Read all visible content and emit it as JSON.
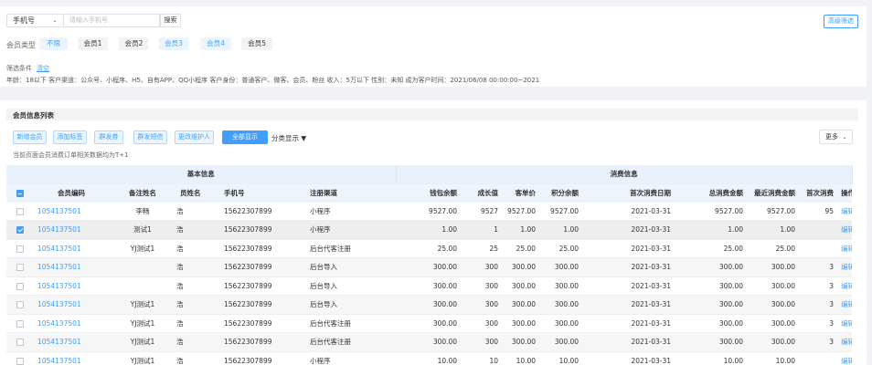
{
  "search": {
    "field_select": "手机号",
    "placeholder": "请输入手机号",
    "search_label": "搜索",
    "advanced_label": "高级筛选"
  },
  "member_type": {
    "label": "会员类型",
    "options": [
      "不限",
      "会员1",
      "会员2",
      "会员3",
      "会员4",
      "会员5"
    ]
  },
  "conditions": {
    "label": "筛选条件",
    "clear": "清空",
    "detail": "年龄：18以下  客户渠道：公众号、小程序、H5、自有APP、QQ小程序  客户身份：普通客户、微客、会员、粉丝  收入：5万以下  性别：未知  成为客户时间：2021/06/08 00:00:00~2021"
  },
  "list": {
    "title": "会员信息列表",
    "actions": [
      "新增会员",
      "添加标签",
      "群发券",
      "群发短信",
      "更改维护人",
      "全部显示"
    ],
    "category_display": "分类显示",
    "more": "更多",
    "note": "当前页面会员消费订单相关数据均为T+1"
  },
  "table": {
    "groups": [
      "基本信息",
      "消费信息"
    ],
    "columns": [
      "会员编码",
      "备注姓名",
      "员姓名",
      "手机号",
      "注册渠道",
      "钱包余额",
      "成长值",
      "客单价",
      "积分余额",
      "首次消费日期",
      "总消费金额",
      "最近消费金额",
      "首次消费",
      "操作"
    ],
    "rows": [
      {
        "code": "1054137501",
        "remark": "李畅",
        "name": "浩",
        "phone": "15622307899",
        "channel": "小程序",
        "wallet": "9527.00",
        "growth": "9527",
        "unit": "9527.00",
        "points": "9527.00",
        "first_date": "2021-03-31",
        "total": "9527.00",
        "recent": "9527.00",
        "first": "95",
        "op": "编辑",
        "checked": false
      },
      {
        "code": "1054137501",
        "remark": "测试1",
        "name": "浩",
        "phone": "15622307899",
        "channel": "小程序",
        "wallet": "1.00",
        "growth": "1",
        "unit": "1.00",
        "points": "1.00",
        "first_date": "2021-03-31",
        "total": "1.00",
        "recent": "1.00",
        "first": "",
        "op": "编辑",
        "checked": true
      },
      {
        "code": "1054137501",
        "remark": "YJ测试1",
        "name": "浩",
        "phone": "15622307899",
        "channel": "后台代客注册",
        "wallet": "25.00",
        "growth": "25",
        "unit": "25.00",
        "points": "25.00",
        "first_date": "2021-03-31",
        "total": "25.00",
        "recent": "25.00",
        "first": "",
        "op": "编辑",
        "checked": false
      },
      {
        "code": "1054137501",
        "remark": "",
        "name": "浩",
        "phone": "15622307899",
        "channel": "后台导入",
        "wallet": "300.00",
        "growth": "300",
        "unit": "300.00",
        "points": "300.00",
        "first_date": "2021-03-31",
        "total": "300.00",
        "recent": "300.00",
        "first": "3",
        "op": "编辑",
        "checked": false
      },
      {
        "code": "1054137501",
        "remark": "",
        "name": "浩",
        "phone": "15622307899",
        "channel": "后台导入",
        "wallet": "300.00",
        "growth": "300",
        "unit": "300.00",
        "points": "300.00",
        "first_date": "2021-03-31",
        "total": "300.00",
        "recent": "300.00",
        "first": "3",
        "op": "编辑",
        "checked": false
      },
      {
        "code": "1054137501",
        "remark": "YJ测试1",
        "name": "浩",
        "phone": "15622307899",
        "channel": "后台导入",
        "wallet": "300.00",
        "growth": "300",
        "unit": "300.00",
        "points": "300.00",
        "first_date": "2021-03-31",
        "total": "300.00",
        "recent": "300.00",
        "first": "3",
        "op": "编辑",
        "checked": false
      },
      {
        "code": "1054137501",
        "remark": "YJ测试1",
        "name": "浩",
        "phone": "15622307899",
        "channel": "后台代客注册",
        "wallet": "300.00",
        "growth": "300",
        "unit": "300.00",
        "points": "300.00",
        "first_date": "2021-03-31",
        "total": "300.00",
        "recent": "300.00",
        "first": "3",
        "op": "编辑",
        "checked": false
      },
      {
        "code": "1054137501",
        "remark": "YJ测试1",
        "name": "浩",
        "phone": "15622307899",
        "channel": "后台代客注册",
        "wallet": "300.00",
        "growth": "300",
        "unit": "300.00",
        "points": "300.00",
        "first_date": "2021-03-31",
        "total": "300.00",
        "recent": "300.00",
        "first": "3",
        "op": "编辑",
        "checked": false
      },
      {
        "code": "1054137501",
        "remark": "YJ测试1",
        "name": "浩",
        "phone": "15622307899",
        "channel": "小程序",
        "wallet": "10.00",
        "growth": "10",
        "unit": "10.00",
        "points": "10.00",
        "first_date": "2021-03-31",
        "total": "10.00",
        "recent": "10.00",
        "first": "",
        "op": "编辑",
        "checked": false
      }
    ]
  },
  "colors": {
    "accent": "#409eff",
    "header_bg": "#e8f1fc"
  },
  "icons": {
    "dropdown": "chevron-down-icon",
    "category_caret": "caret-down-icon"
  }
}
